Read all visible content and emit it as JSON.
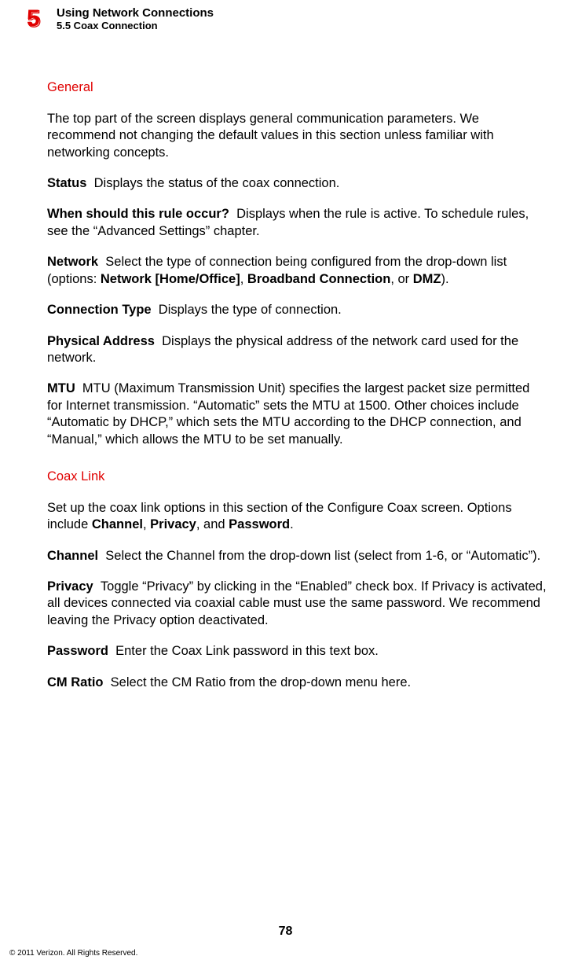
{
  "header": {
    "chapter_number": "5",
    "chapter_title": "Using Network Connections",
    "section_line": "5.5  Coax Connection"
  },
  "sections": {
    "general": {
      "heading": "General",
      "intro": "The top part of the screen displays general communication parameters. We recommend not changing the default values in this section unless familiar with networking concepts.",
      "status_label": "Status",
      "status_body": "Displays the status of the coax connection.",
      "rule_label": "When should this rule occur?",
      "rule_body": "Displays when the rule is active. To schedule rules, see the “Advanced Settings” chapter.",
      "network_label": "Network",
      "network_body_pre": "Select the type of connection being configured from the drop-down list (options: ",
      "network_opt1": "Network [Home/Office]",
      "network_sep1": ", ",
      "network_opt2": "Broadband Connection",
      "network_sep2": ", or ",
      "network_opt3": "DMZ",
      "network_body_post": ").",
      "conntype_label": "Connection Type",
      "conntype_body": "Displays the type of connection.",
      "physaddr_label": "Physical Address",
      "physaddr_body": "Displays the physical address of the network card used for the network.",
      "mtu_label": "MTU",
      "mtu_body": "MTU (Maximum Transmission Unit) specifies the largest packet size permitted for Internet transmission. “Automatic” sets the MTU at 1500. Other choices include “Automatic by DHCP,” which sets the MTU according to the DHCP connection, and “Manual,” which allows the MTU to be set manually."
    },
    "coax": {
      "heading": "Coax Link",
      "intro_pre": "Set up the coax link options in this section of the Configure Coax screen. Options include ",
      "intro_b1": "Channel",
      "intro_s1": ", ",
      "intro_b2": "Privacy",
      "intro_s2": ", and ",
      "intro_b3": "Password",
      "intro_post": ".",
      "channel_label": "Channel",
      "channel_body": "Select the Channel from the drop-down list (select from 1-6,  or “Automatic”).",
      "privacy_label": "Privacy",
      "privacy_body": "Toggle “Privacy” by clicking in the “Enabled” check box. If Privacy is activated, all devices connected via coaxial cable must use the same password. We recommend leaving the Privacy option deactivated.",
      "password_label": "Password",
      "password_body": "Enter the Coax Link password in this text box.",
      "cmratio_label": "CM Ratio",
      "cmratio_body": "Select the CM Ratio from the drop-down menu here."
    }
  },
  "footer": {
    "page_number": "78",
    "copyright": "© 2011 Verizon. All Rights Reserved."
  }
}
